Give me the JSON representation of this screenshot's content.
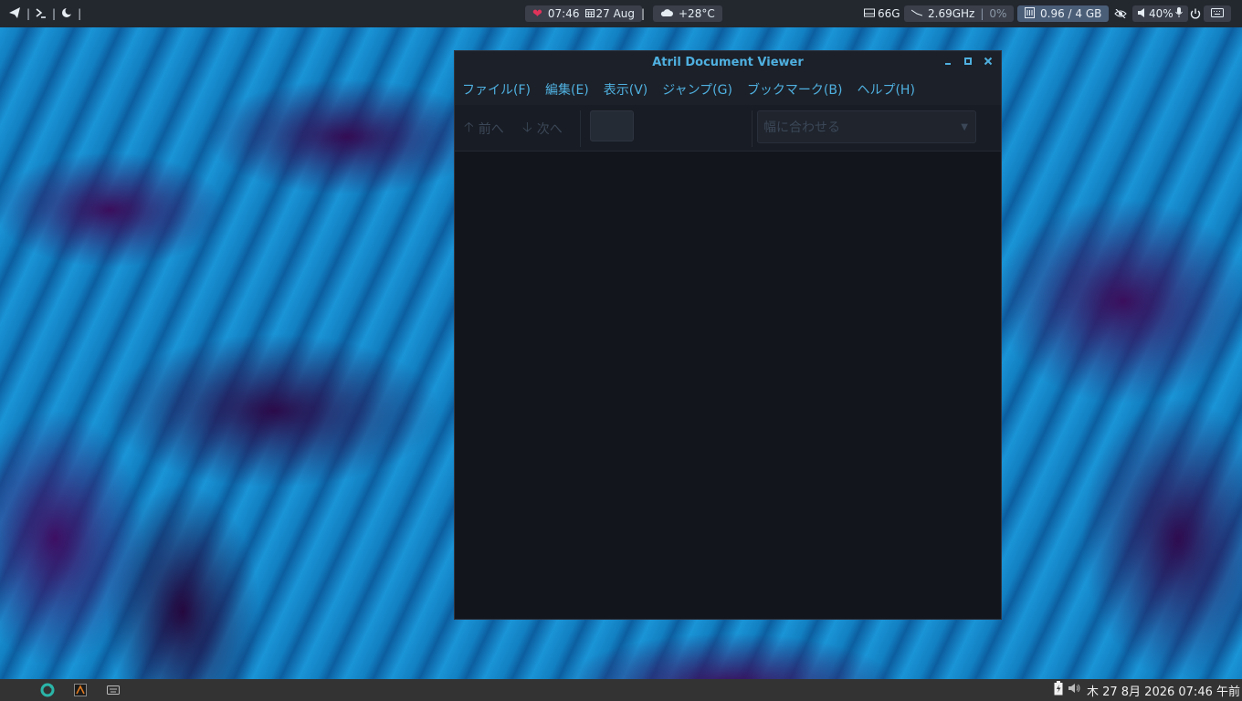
{
  "topbar": {
    "left_icons": [
      "send-icon",
      "terminal-icon",
      "moon-icon"
    ],
    "separator": "|",
    "center": {
      "time": "07:46",
      "date": "27 Aug",
      "separator": "|",
      "weather": "+28°C"
    },
    "right": {
      "disk": "66G",
      "cpu_freq": "2.69GHz",
      "cpu_sep": "|",
      "cpu_usage": "0%",
      "memory": "0.96 / 4 GB",
      "volume": "40%"
    }
  },
  "window": {
    "title": "Atril Document Viewer",
    "menu": [
      "ファイル(F)",
      "編集(E)",
      "表示(V)",
      "ジャンプ(G)",
      "ブックマーク(B)",
      "ヘルプ(H)"
    ],
    "toolbar": {
      "prev_label": "前へ",
      "next_label": "次へ",
      "page_value": "",
      "zoom_value": "幅に合わせる"
    }
  },
  "bottombar": {
    "clock": "木 27  8月 2026 07:46 午前"
  },
  "colors": {
    "accent": "#4fb0e0",
    "panel": "#23272e",
    "window_bg": "#12151c"
  }
}
